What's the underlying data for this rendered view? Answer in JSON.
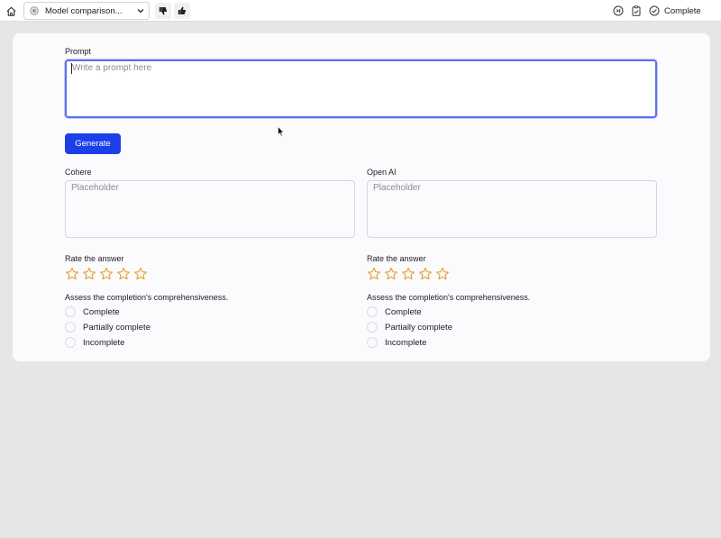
{
  "topbar": {
    "task_title": "Model comparison...",
    "complete_label": "Complete",
    "icons": [
      "home-icon",
      "task-status-icon",
      "chevron-down-icon",
      "thumbs-down-icon",
      "thumbs-up-icon",
      "record-icon",
      "clipboard-check-icon",
      "check-circle-icon"
    ]
  },
  "prompt": {
    "label": "Prompt",
    "placeholder": "Write a prompt here",
    "value": ""
  },
  "generate_label": "Generate",
  "left_panel": {
    "model_label": "Cohere",
    "response_placeholder": "Placeholder",
    "rate_label": "Rate the answer",
    "rating": 0,
    "max_rating": 5,
    "assess_label": "Assess the completion's comprehensiveness.",
    "options": [
      "Complete",
      "Partially complete",
      "Incomplete"
    ]
  },
  "right_panel": {
    "model_label": "Open AI",
    "response_placeholder": "Placeholder",
    "rate_label": "Rate the answer",
    "rating": 0,
    "max_rating": 5,
    "assess_label": "Assess the completion's comprehensiveness.",
    "options": [
      "Complete",
      "Partially complete",
      "Incomplete"
    ]
  },
  "colors": {
    "primary": "#1d3fe8",
    "focus_ring": "#5b72e8",
    "star": "#e0a030",
    "background": "#e6e5e8",
    "card": "#fbfafd"
  }
}
